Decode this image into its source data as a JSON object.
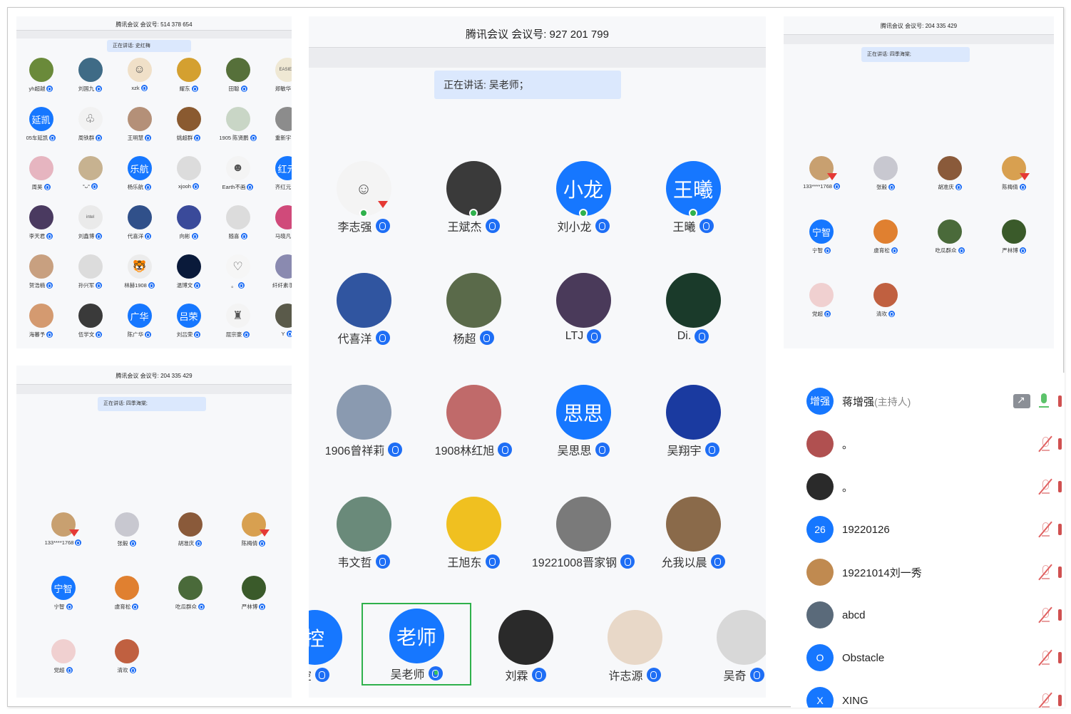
{
  "panel_a": {
    "title": "腾讯会议 会议号: 514 378 654",
    "speaking": "正在讲话: 史红梅",
    "participants": [
      {
        "name": "yh超越",
        "bg": "#6a8a3a"
      },
      {
        "name": "刘国九",
        "bg": "#3f6b86"
      },
      {
        "name": "xzk",
        "bg": "#f0e0c8",
        "glyph": "☺",
        "dark": true
      },
      {
        "name": "耀东",
        "bg": "#d4a030"
      },
      {
        "name": "田聪",
        "bg": "#56703a"
      },
      {
        "name": "郑敏华",
        "bg": "#efe8d4",
        "glyph": "EASIER",
        "dark": true
      },
      {
        "name": "05车延凯",
        "bg": "#1677ff",
        "text": "延凯"
      },
      {
        "name": "周铁群",
        "bg": "#f2f2f2",
        "glyph": "♧",
        "dark": true
      },
      {
        "name": "王明慧",
        "bg": "#b49078"
      },
      {
        "name": "姚超群",
        "bg": "#8a5a30"
      },
      {
        "name": "1905 陈贤鹏",
        "bg": "#c9d6c6"
      },
      {
        "name": "重新宇",
        "bg": "#8c8c8c"
      },
      {
        "name": "周昊",
        "bg": "#e6b5c0"
      },
      {
        "name": "°ᴗ°",
        "bg": "#c7b290"
      },
      {
        "name": "杨乐航",
        "bg": "#1677ff",
        "text": "乐航"
      },
      {
        "name": "xjooh",
        "bg": "#dcdcdc"
      },
      {
        "name": "Earth不画",
        "bg": "#f4f4f4",
        "glyph": "☻",
        "dark": true
      },
      {
        "name": "齐红元",
        "bg": "#1677ff",
        "text": "红元"
      },
      {
        "name": "李天君",
        "bg": "#4a3a60"
      },
      {
        "name": "刘鑫博",
        "bg": "#eaeaea",
        "glyph": "intel",
        "dark": true
      },
      {
        "name": "代喜洋",
        "bg": "#30508a"
      },
      {
        "name": "向彬",
        "bg": "#3a4a9a"
      },
      {
        "name": "随喜",
        "bg": "#dcdcdc"
      },
      {
        "name": "马晓凡",
        "bg": "#d04a7a"
      },
      {
        "name": "贺浩楠",
        "bg": "#c8a080"
      },
      {
        "name": "孙兴军",
        "bg": "#dcdcdc"
      },
      {
        "name": "林赫1908",
        "bg": "#ececec",
        "glyph": "🐯",
        "dark": true
      },
      {
        "name": "温博文",
        "bg": "#0a1a3a"
      },
      {
        "name": "。",
        "bg": "#f6f6f6",
        "glyph": "♡",
        "dark": true
      },
      {
        "name": "纤纤素手",
        "bg": "#8a8ab0"
      },
      {
        "name": "海暮予",
        "bg": "#d49a70"
      },
      {
        "name": "伍学文",
        "bg": "#3a3a3a"
      },
      {
        "name": "陈广华",
        "bg": "#1677ff",
        "text": "广华"
      },
      {
        "name": "刘吕荣",
        "bg": "#1677ff",
        "text": "吕荣"
      },
      {
        "name": "屈宗豪",
        "bg": "#f4f4f4",
        "glyph": "♜",
        "dark": true
      },
      {
        "name": "Y",
        "bg": "#5a5a4a"
      }
    ]
  },
  "panel_b": {
    "title": "腾讯会议 会议号: 927 201 799",
    "speaking": "正在讲话: 吴老师；",
    "participants": [
      {
        "name": "李志强",
        "bg": "#f4f4f4",
        "glyph": "☺",
        "dark": true,
        "online": true,
        "flag": true
      },
      {
        "name": "王斌杰",
        "bg": "#3a3a3a",
        "online": true
      },
      {
        "name": "刘小龙",
        "bg": "#1677ff",
        "text": "小龙",
        "online": true
      },
      {
        "name": "王曦",
        "bg": "#1677ff",
        "text": "王曦",
        "online": true
      },
      {
        "name": "代喜洋",
        "bg": "#3055a0"
      },
      {
        "name": "杨超",
        "bg": "#5a6a4a"
      },
      {
        "name": "LTJ",
        "bg": "#4a3a5a"
      },
      {
        "name": "Di.",
        "bg": "#1a3a2a"
      },
      {
        "name": "1906曾祥莉",
        "bg": "#8a9ab0"
      },
      {
        "name": "1908林红旭",
        "bg": "#c06a6a"
      },
      {
        "name": "吴思思",
        "bg": "#1677ff",
        "text": "思思"
      },
      {
        "name": "吴翔宇",
        "bg": "#1a3aa0"
      },
      {
        "name": "韦文哲",
        "bg": "#6a8a7a"
      },
      {
        "name": "王旭东",
        "bg": "#f0c020"
      },
      {
        "name": "19221008晋家钢",
        "bg": "#7a7a7a"
      },
      {
        "name": "允我以晨",
        "bg": "#8a6a4a"
      }
    ],
    "bottom_row": [
      {
        "name": "控",
        "bg": "#1677ff",
        "text": "控"
      },
      {
        "name": "吴老师",
        "bg": "#1677ff",
        "text": "老师",
        "active": true
      },
      {
        "name": "刘霖",
        "bg": "#2a2a2a"
      },
      {
        "name": "许志源",
        "bg": "#e8d8c8"
      },
      {
        "name": "吴奇",
        "bg": "#d8d8d8"
      }
    ]
  },
  "panel_c": {
    "title": "腾讯会议 会议号: 204 335 429",
    "speaking": "正在讲话: 四季海棠;",
    "participants": [
      {
        "name": "133****1768",
        "bg": "#c8a070",
        "flag": true
      },
      {
        "name": "张毅",
        "bg": "#c8c8d0"
      },
      {
        "name": "胡准庆",
        "bg": "#8a5a3a"
      },
      {
        "name": "陈梅倩",
        "bg": "#d8a050",
        "flag": true
      },
      {
        "name": "宁智",
        "bg": "#1677ff",
        "text": "宁智"
      },
      {
        "name": "虞育松",
        "bg": "#e08030"
      },
      {
        "name": "吃瓜群众",
        "bg": "#4a6a3a"
      },
      {
        "name": "严林博",
        "bg": "#3a5a2a"
      },
      {
        "name": "党超",
        "bg": "#f0d0d0"
      },
      {
        "name": "清欢",
        "bg": "#c06040"
      }
    ]
  },
  "panel_d": {
    "title": "腾讯会议 会议号: 204 335 429",
    "speaking": "正在讲话: 四季海棠;",
    "participants": [
      {
        "name": "133****1768",
        "bg": "#c8a070",
        "flag": true
      },
      {
        "name": "张毅",
        "bg": "#c8c8d0"
      },
      {
        "name": "胡准庆",
        "bg": "#8a5a3a"
      },
      {
        "name": "陈梅倩",
        "bg": "#d8a050",
        "flag": true
      },
      {
        "name": "宁智",
        "bg": "#1677ff",
        "text": "宁智"
      },
      {
        "name": "虞育松",
        "bg": "#e08030"
      },
      {
        "name": "吃瓜群众",
        "bg": "#4a6a3a"
      },
      {
        "name": "严林博",
        "bg": "#3a5a2a"
      },
      {
        "name": "党超",
        "bg": "#f0d0d0"
      },
      {
        "name": "清欢",
        "bg": "#c06040"
      }
    ]
  },
  "member_list": [
    {
      "name": "蒋增强",
      "host": "(主持人)",
      "bg": "#1677ff",
      "text": "增强",
      "speaking": true
    },
    {
      "name": "。",
      "bg": "#b05050"
    },
    {
      "name": "。",
      "bg": "#2a2a2a"
    },
    {
      "name": "19220126",
      "bg": "#1677ff",
      "text": "26"
    },
    {
      "name": "19221014刘一秀",
      "bg": "#c08a50"
    },
    {
      "name": "abcd",
      "bg": "#5a6a7a"
    },
    {
      "name": "Obstacle",
      "bg": "#1677ff",
      "text": "O"
    },
    {
      "name": "XING",
      "bg": "#1677ff",
      "text": "X"
    }
  ],
  "colors": {
    "accent": "#1677ff",
    "speaker_bg": "#dbe8fd",
    "active_border": "#2fb14c",
    "mute_red": "#e06060"
  }
}
